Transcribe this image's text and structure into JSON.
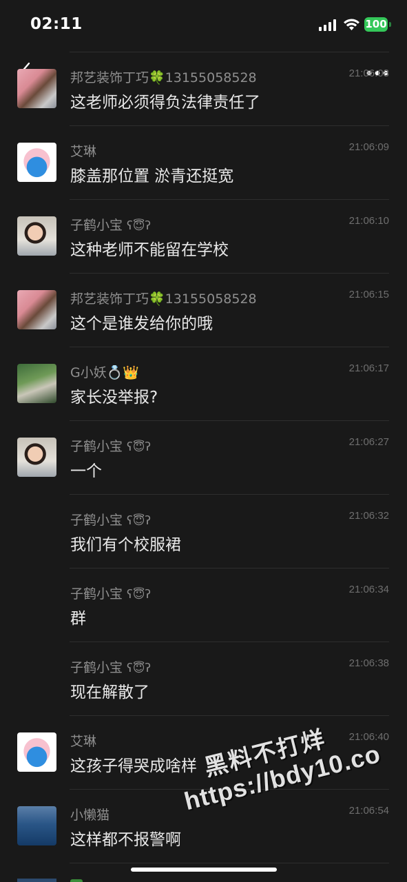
{
  "status_bar": {
    "time": "02:11",
    "battery": "100"
  },
  "messages": [
    {
      "sender": "邦艺装饰丁巧🍀13155058528",
      "extra": "",
      "time": "21:06:08",
      "text": "这老师必须得负法律责任了",
      "avatar": "avatar-woman-laptop"
    },
    {
      "sender": "艾琳",
      "extra": "",
      "time": "21:06:09",
      "text": "膝盖那位置 淤青还挺宽",
      "avatar": "avatar-doraemon-bunny"
    },
    {
      "sender": "子鹤小宝",
      "extra": "ʕ😇ʔ",
      "time": "21:06:10",
      "text": "这种老师不能留在学校",
      "avatar": "avatar-child"
    },
    {
      "sender": "邦艺装饰丁巧🍀13155058528",
      "extra": "",
      "time": "21:06:15",
      "text": "这个是谁发给你的哦",
      "avatar": "avatar-woman-laptop"
    },
    {
      "sender": "G小妖💍👑",
      "extra": "",
      "time": "21:06:17",
      "text": "家长没举报?",
      "avatar": "avatar-outdoor-person"
    },
    {
      "sender": "子鹤小宝",
      "extra": "ʕ😇ʔ",
      "time": "21:06:27",
      "text": "一个",
      "avatar": "avatar-child"
    },
    {
      "sender": "子鹤小宝",
      "extra": "ʕ😇ʔ",
      "time": "21:06:32",
      "text": "我们有个校服裙",
      "avatar": ""
    },
    {
      "sender": "子鹤小宝",
      "extra": "ʕ😇ʔ",
      "time": "21:06:34",
      "text": "群",
      "avatar": ""
    },
    {
      "sender": "子鹤小宝",
      "extra": "ʕ😇ʔ",
      "time": "21:06:38",
      "text": "现在解散了",
      "avatar": ""
    },
    {
      "sender": "艾琳",
      "extra": "",
      "time": "21:06:40",
      "text": "这孩子得哭成啥样",
      "avatar": "avatar-doraemon-bunny"
    },
    {
      "sender": "小懒猫",
      "extra": "",
      "time": "21:06:54",
      "text": "这样都不报警啊",
      "avatar": "avatar-ocean"
    }
  ],
  "watermark": {
    "line1": "黑料不打烊",
    "line2": "https://bdy10.co"
  },
  "colors": {
    "background": "#191919",
    "battery_green": "#34c759",
    "sender_gray": "#8f8f8f",
    "time_gray": "#6e6e6e"
  },
  "icons": [
    "back-chevron-icon",
    "more-dots-icon",
    "signal-icon",
    "wifi-icon",
    "battery-icon"
  ]
}
